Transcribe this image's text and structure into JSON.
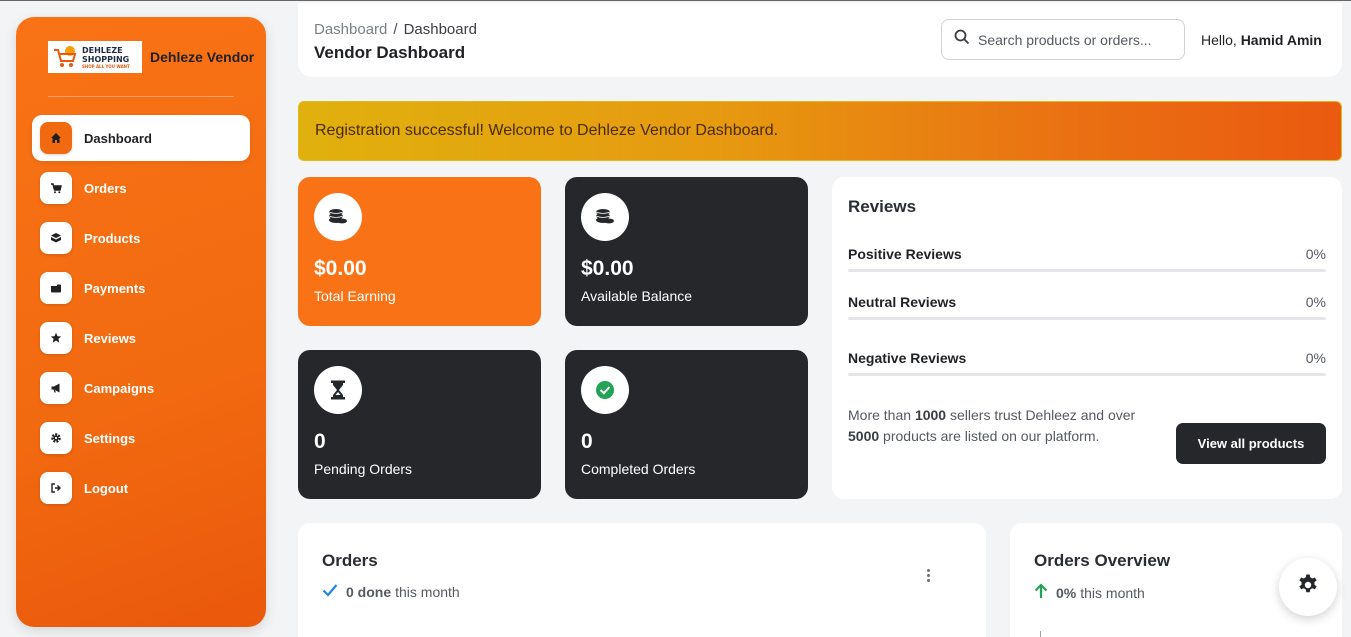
{
  "sidebar": {
    "logo": {
      "line1": "DEHLEZE",
      "line2": "SHOPPING",
      "tagline": "SHOP ALL YOU WANT"
    },
    "brand_name": "Dehleze Vendor",
    "items": [
      {
        "label": "Dashboard",
        "icon": "home-icon",
        "active": true
      },
      {
        "label": "Orders",
        "icon": "cart-icon"
      },
      {
        "label": "Products",
        "icon": "box-icon"
      },
      {
        "label": "Payments",
        "icon": "wallet-icon"
      },
      {
        "label": "Reviews",
        "icon": "star-icon"
      },
      {
        "label": "Campaigns",
        "icon": "megaphone-icon"
      },
      {
        "label": "Settings",
        "icon": "gear-icon"
      },
      {
        "label": "Logout",
        "icon": "logout-icon"
      }
    ]
  },
  "header": {
    "breadcrumb": {
      "root": "Dashboard",
      "separator": "/",
      "current": "Dashboard"
    },
    "title": "Vendor Dashboard",
    "search_placeholder": "Search products or orders...",
    "greeting_prefix": "Hello,",
    "user_name": "Hamid Amin"
  },
  "alert": {
    "message": "Registration successful! Welcome to Dehleze Vendor Dashboard."
  },
  "stats": [
    {
      "value": "$0.00",
      "label": "Total Earning",
      "icon": "coins-icon",
      "theme": "orange"
    },
    {
      "value": "$0.00",
      "label": "Available Balance",
      "icon": "coins-icon",
      "theme": "dark"
    },
    {
      "value": "0",
      "label": "Pending Orders",
      "icon": "hourglass-icon",
      "theme": "dark"
    },
    {
      "value": "0",
      "label": "Completed Orders",
      "icon": "check-circle-icon",
      "theme": "dark"
    }
  ],
  "reviews": {
    "title": "Reviews",
    "rows": [
      {
        "name": "Positive Reviews",
        "percent_label": "0%",
        "percent": 0
      },
      {
        "name": "Neutral Reviews",
        "percent_label": "0%",
        "percent": 0
      },
      {
        "name": "Negative Reviews",
        "percent_label": "0%",
        "percent": 0
      }
    ],
    "trust": {
      "part1": "More than ",
      "sellers": "1000",
      "part2": " sellers trust Dehleez and over ",
      "products": "5000",
      "part3": " products are listed on our platform."
    },
    "button_label": "View all products"
  },
  "orders_panel": {
    "title": "Orders",
    "count": "0 done",
    "suffix": "this month"
  },
  "overview_panel": {
    "title": "Orders Overview",
    "percent": "0%",
    "suffix": "this month"
  },
  "colors": {
    "accent": "#f97316",
    "dark": "#25272b",
    "success": "#22a355",
    "info": "#1e88e5"
  }
}
